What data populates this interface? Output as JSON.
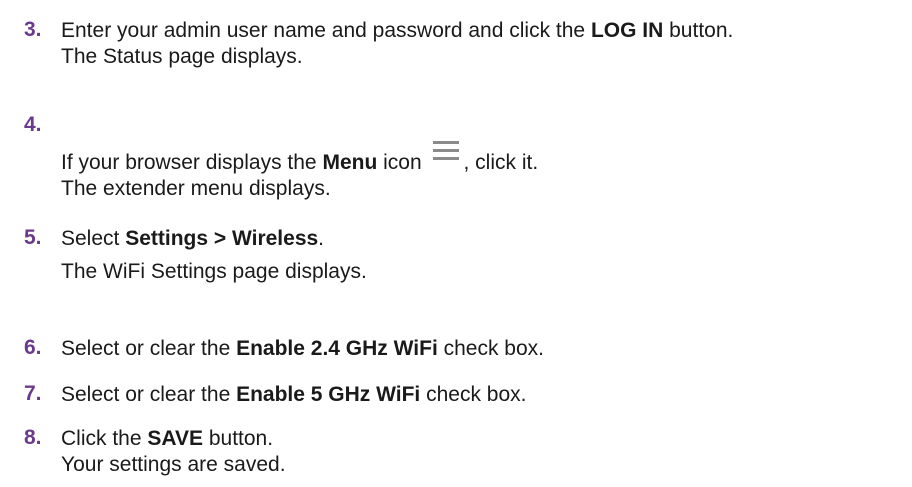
{
  "steps": [
    {
      "number": "3.",
      "lines": [
        {
          "pre": "Enter your admin user name and password and click the ",
          "bold": "LOG IN",
          "post": " button."
        },
        {
          "text": "The Status page displays."
        }
      ]
    },
    {
      "number": "4.",
      "lines": [
        {
          "pre": "If your browser displays the ",
          "bold": "Menu",
          "mid": " icon ",
          "icon": "menu-hamburger-icon",
          "post": ", click it."
        },
        {
          "text": "The extender menu displays."
        }
      ]
    },
    {
      "number": "5.",
      "lines": [
        {
          "pre": "Select ",
          "bold": "Settings > Wireless",
          "post": "."
        },
        {
          "text": "The WiFi Settings page displays."
        }
      ]
    },
    {
      "number": "6.",
      "lines": [
        {
          "pre": "Select or clear the ",
          "bold": "Enable 2.4 GHz WiFi",
          "post": " check box."
        }
      ]
    },
    {
      "number": "7.",
      "lines": [
        {
          "pre": "Select or clear the ",
          "bold": "Enable 5 GHz WiFi",
          "post": " check box."
        }
      ]
    },
    {
      "number": "8.",
      "lines": [
        {
          "pre": "Click the ",
          "bold": "SAVE",
          "post": " button."
        },
        {
          "text": "Your settings are saved."
        }
      ]
    }
  ],
  "colors": {
    "step_number": "#6b3a8c",
    "text": "#1a1a1a",
    "icon": "#8a8a8a"
  }
}
